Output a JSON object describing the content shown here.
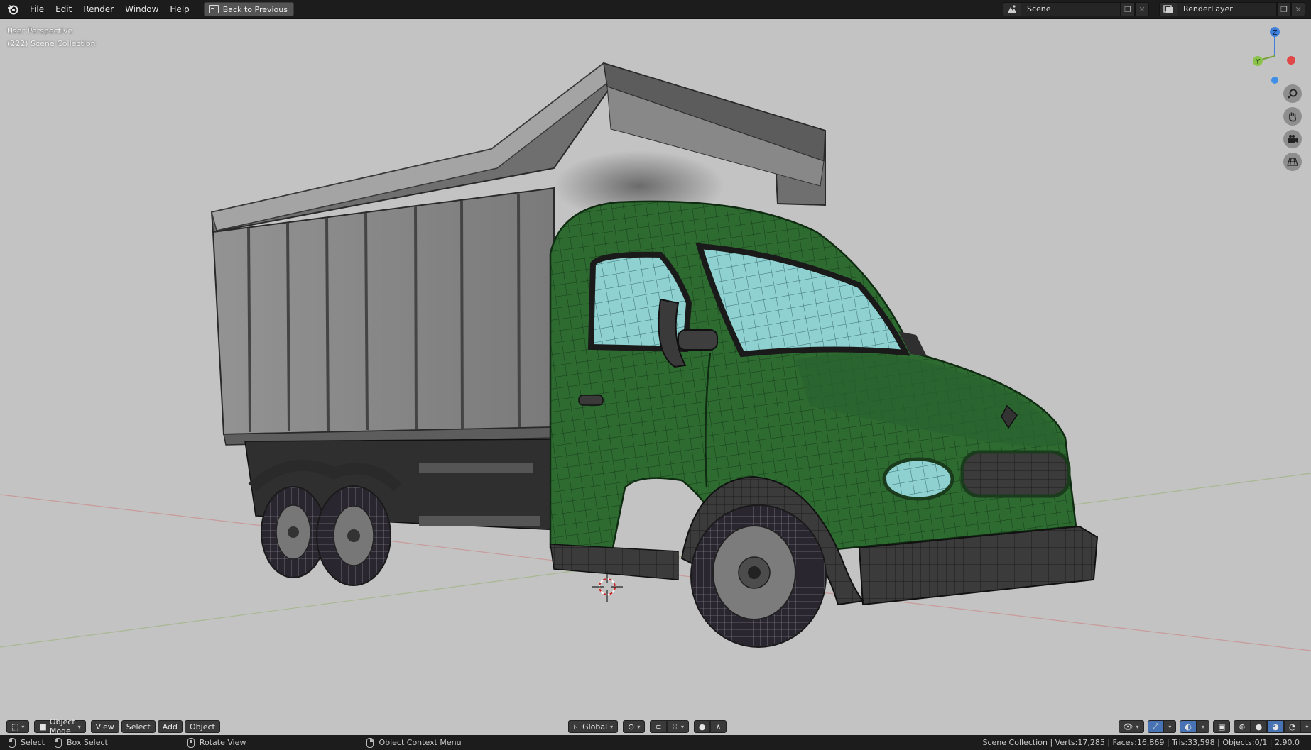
{
  "topbar": {
    "menus": [
      "File",
      "Edit",
      "Render",
      "Window",
      "Help"
    ],
    "back_button": "Back to Previous",
    "scene_name": "Scene",
    "view_layer_name": "RenderLayer"
  },
  "viewport": {
    "perspective_label": "User Perspective",
    "collection_label": "(222) Scene Collection",
    "gizmo_axes": {
      "z": "Z",
      "y": "Y",
      "x": "X"
    },
    "colors": {
      "background": "#c3c3c3",
      "truck_body": "#2c6a30",
      "glass": "#8ecfcf",
      "dump_box": "#8a8a8a",
      "axis_x": "#d44444",
      "axis_y": "#7aa33a",
      "axis_z": "#3f7fd9"
    }
  },
  "viewport_header": {
    "mode": "Object Mode",
    "menus": [
      "View",
      "Select",
      "Add",
      "Object"
    ],
    "transform_orientation": "Global"
  },
  "statusbar": {
    "select": "Select",
    "box_select": "Box Select",
    "rotate_view": "Rotate View",
    "context_menu": "Object Context Menu",
    "stats": "Scene Collection | Verts:17,285 | Faces:16,869 | Tris:33,598 | Objects:0/1 | 2.90.0"
  }
}
